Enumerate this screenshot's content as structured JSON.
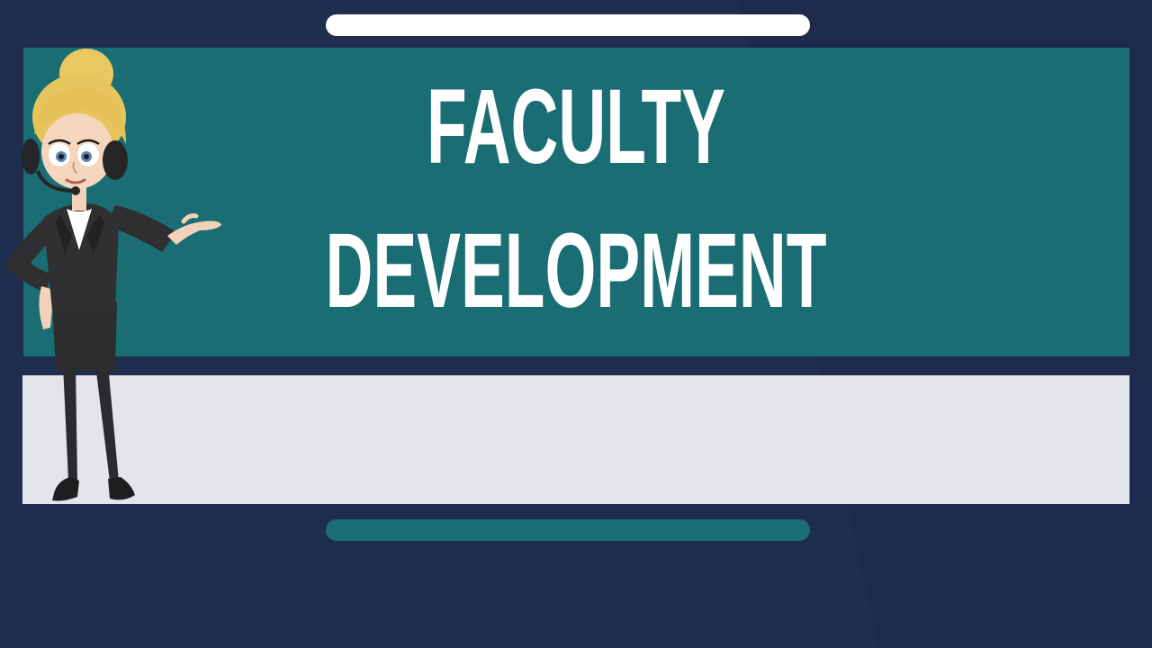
{
  "title": {
    "line1": "FACULTY",
    "line2": "DEVELOPMENT"
  },
  "subtitle": "",
  "colors": {
    "background": "#1f2d4f",
    "title_panel": "#1a6d72",
    "subtitle_panel": "#e4e5ea",
    "title_text": "#ffffff",
    "top_pill": "#ffffff",
    "bottom_pill": "#1a6d72"
  },
  "icons": {
    "presenter": "cartoon-presenter-illustration"
  }
}
